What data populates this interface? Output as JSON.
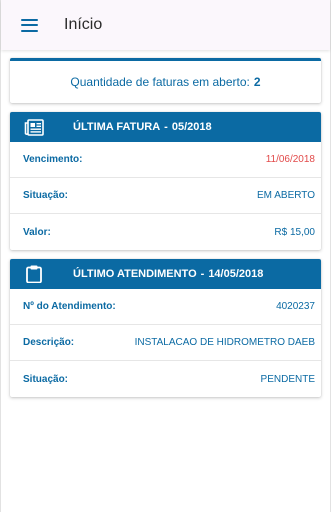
{
  "header": {
    "title": "Início",
    "menu_icon": "menu-icon"
  },
  "summary": {
    "label": "Quantidade de faturas em aberto:",
    "count": "2"
  },
  "invoice": {
    "title": "ÚLTIMA FATURA",
    "period": "05/2018",
    "icon": "newspaper-icon",
    "rows": [
      {
        "label": "Vencimento:",
        "value": "11/06/2018",
        "color": "#e24a4a"
      },
      {
        "label": "Situação:",
        "value": "EM ABERTO"
      },
      {
        "label": "Valor:",
        "value": "R$ 15,00"
      }
    ]
  },
  "service": {
    "title": "ÚLTIMO ATENDIMENTO",
    "date": "14/05/2018",
    "icon": "clipboard-icon",
    "rows": [
      {
        "label": "Nº do Atendimento:",
        "value": "4020237"
      },
      {
        "label": "Descrição:",
        "value": "INSTALACAO DE HIDROMETRO DAEB"
      },
      {
        "label": "Situação:",
        "value": "PENDENTE"
      }
    ]
  },
  "colors": {
    "primary": "#0b6aa3",
    "due": "#e24a4a",
    "header_bg": "#fbf7fc"
  }
}
